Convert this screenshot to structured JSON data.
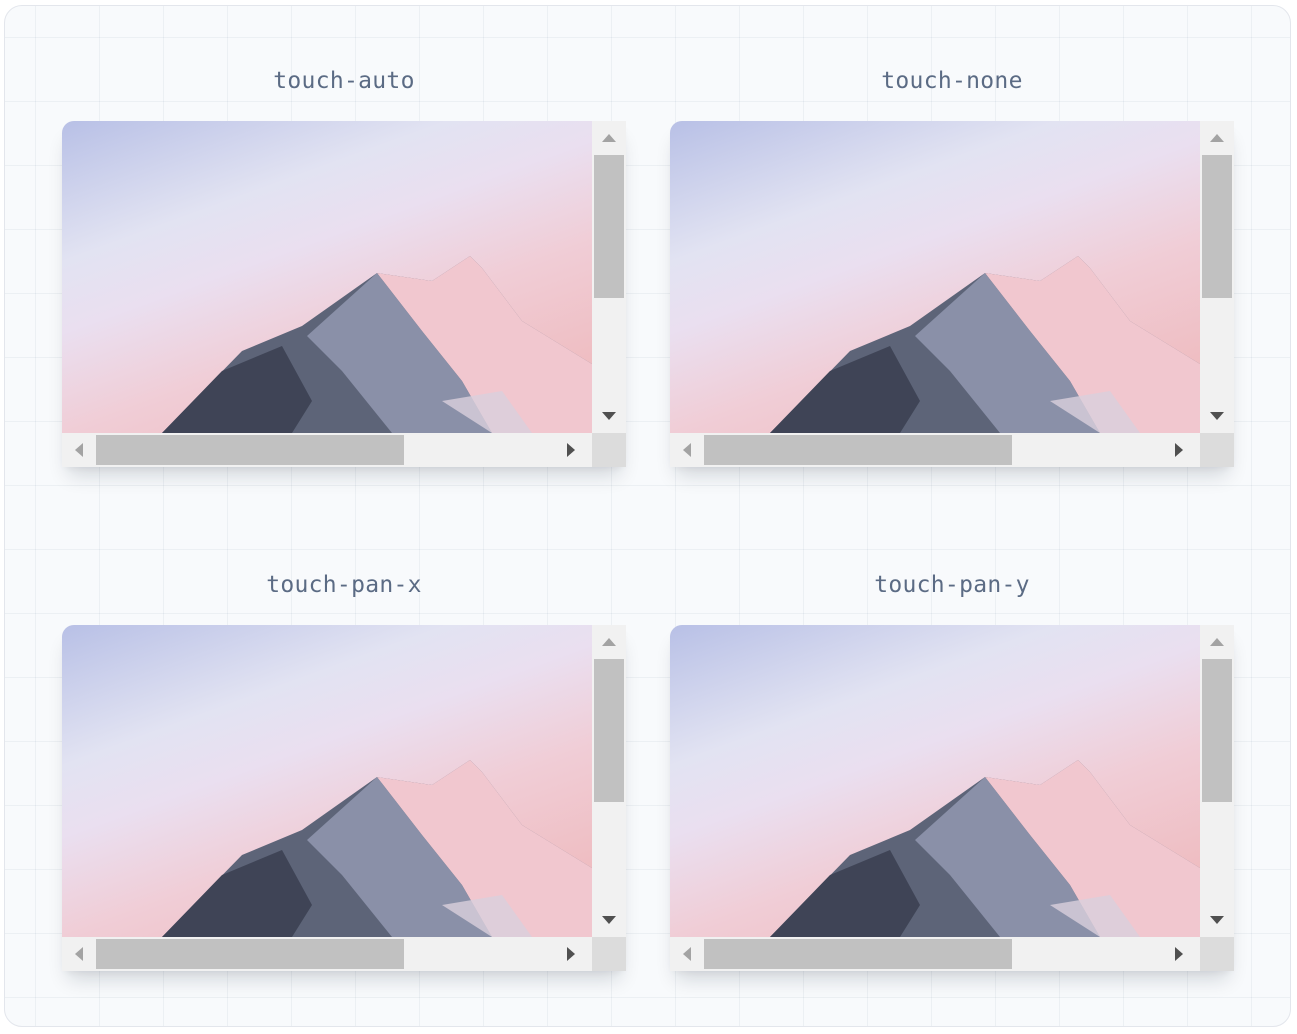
{
  "demos": [
    {
      "label": "touch-auto",
      "image": "mountain-peak-image"
    },
    {
      "label": "touch-none",
      "image": "mountain-peak-image"
    },
    {
      "label": "touch-pan-x",
      "image": "mountain-peak-image"
    },
    {
      "label": "touch-pan-y",
      "image": "mountain-peak-image"
    }
  ],
  "colors": {
    "label_text": "#5b6b84",
    "background": "#f8fafc",
    "scrollbar_track": "#f1f1f1",
    "scrollbar_thumb": "#c1c1c1"
  },
  "icons": {
    "scroll_up": "triangle-up-icon",
    "scroll_down": "triangle-down-icon",
    "scroll_left": "triangle-left-icon",
    "scroll_right": "triangle-right-icon"
  }
}
